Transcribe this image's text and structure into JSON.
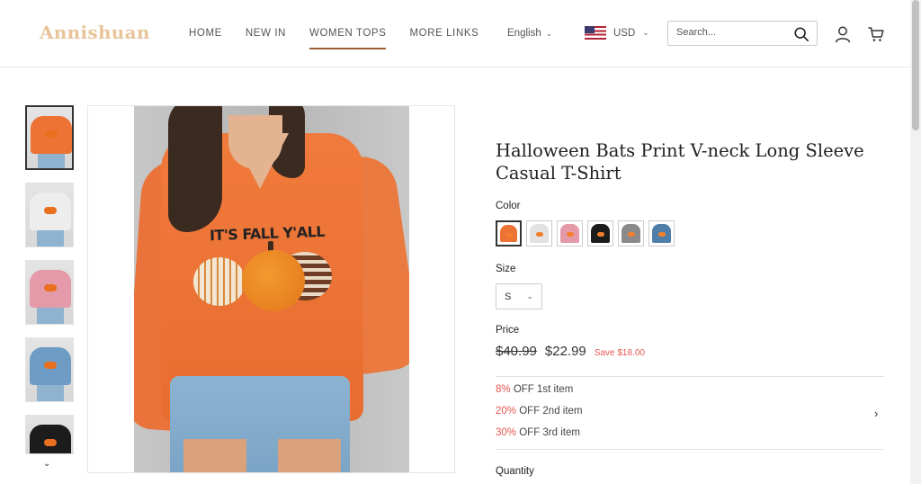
{
  "header": {
    "logo": "Annishuan",
    "nav": [
      "HOME",
      "NEW IN",
      "WOMEN TOPS",
      "MORE LINKS"
    ],
    "active_nav": "WOMEN TOPS",
    "language": "English",
    "currency": "USD",
    "search_placeholder": "Search..."
  },
  "icons": {
    "search": "search-icon",
    "account": "user-icon",
    "cart": "cart-icon",
    "dropdown": "chevron-down-icon",
    "next": "chevron-right-icon"
  },
  "gallery": {
    "thumbnails": [
      "orange",
      "white",
      "pink",
      "blue",
      "black"
    ],
    "thumb_colors": [
      "#ec7333",
      "#e9e9e9",
      "#e49aa8",
      "#6e9cc4",
      "#1c1c1c"
    ],
    "main_print": "IT'S FALL Y'ALL"
  },
  "product": {
    "title": "Halloween Bats Print V-neck Long Sleeve Casual T-Shirt",
    "color_label": "Color",
    "color_swatches": [
      "#ec7333",
      "#e2e2e2",
      "#e49aa8",
      "#1c1c1c",
      "#8a8a8a",
      "#4f7ea8"
    ],
    "size_label": "Size",
    "size_value": "S",
    "price_label": "Price",
    "original_price": "$40.99",
    "sale_price": "$22.99",
    "save_text": "Save $18.00",
    "offers": [
      {
        "pct": "8%",
        "text": " OFF 1st item"
      },
      {
        "pct": "20%",
        "text": " OFF 2nd item"
      },
      {
        "pct": "30%",
        "text": " OFF 3rd item"
      }
    ],
    "quantity_label": "Quantity"
  },
  "colors": {
    "logo": "#e8c49a",
    "accent_underline": "#a0603a",
    "discount": "#e4564f"
  }
}
